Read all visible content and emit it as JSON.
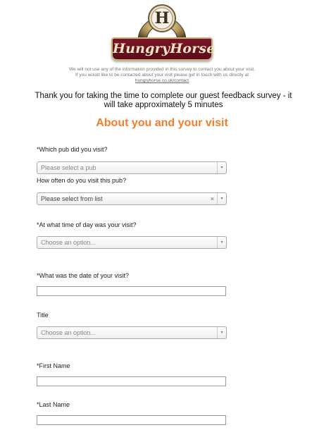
{
  "brand": {
    "logo_text": "HungryHorse",
    "emblem_letter": "H",
    "colors": {
      "accent": "#ef7f2e",
      "banner": "#6b1020",
      "gold": "#c9b27a"
    }
  },
  "privacy": {
    "line1": "We will not use any of the information provided in this survey to contact you about your visit.",
    "line2": "If you would like to be contacted about your visit please get in touch with us directly at",
    "link": "hungryhorse.co.uk/contact"
  },
  "intro": "Thank you for taking the time to complete our guest feedback survey - it will take approximately 5 minutes",
  "section_title": "About you and your visit",
  "questions": {
    "pub": {
      "label": "*Which pub did you visit?",
      "placeholder": "Please select a pub"
    },
    "frequency": {
      "label": "How often do you visit this pub?",
      "value": "Please select from list",
      "clear": "×"
    },
    "time": {
      "label": "*At what time of day was your visit?",
      "placeholder": "Choose an option..."
    },
    "date": {
      "label": "*What was the date of your visit?",
      "value": ""
    },
    "title": {
      "label": "Title",
      "placeholder": "Choose an option..."
    },
    "first_name": {
      "label": "*First Name",
      "value": ""
    },
    "last_name": {
      "label": "*Last Name",
      "value": ""
    }
  },
  "icons": {
    "dropdown": "▾"
  }
}
